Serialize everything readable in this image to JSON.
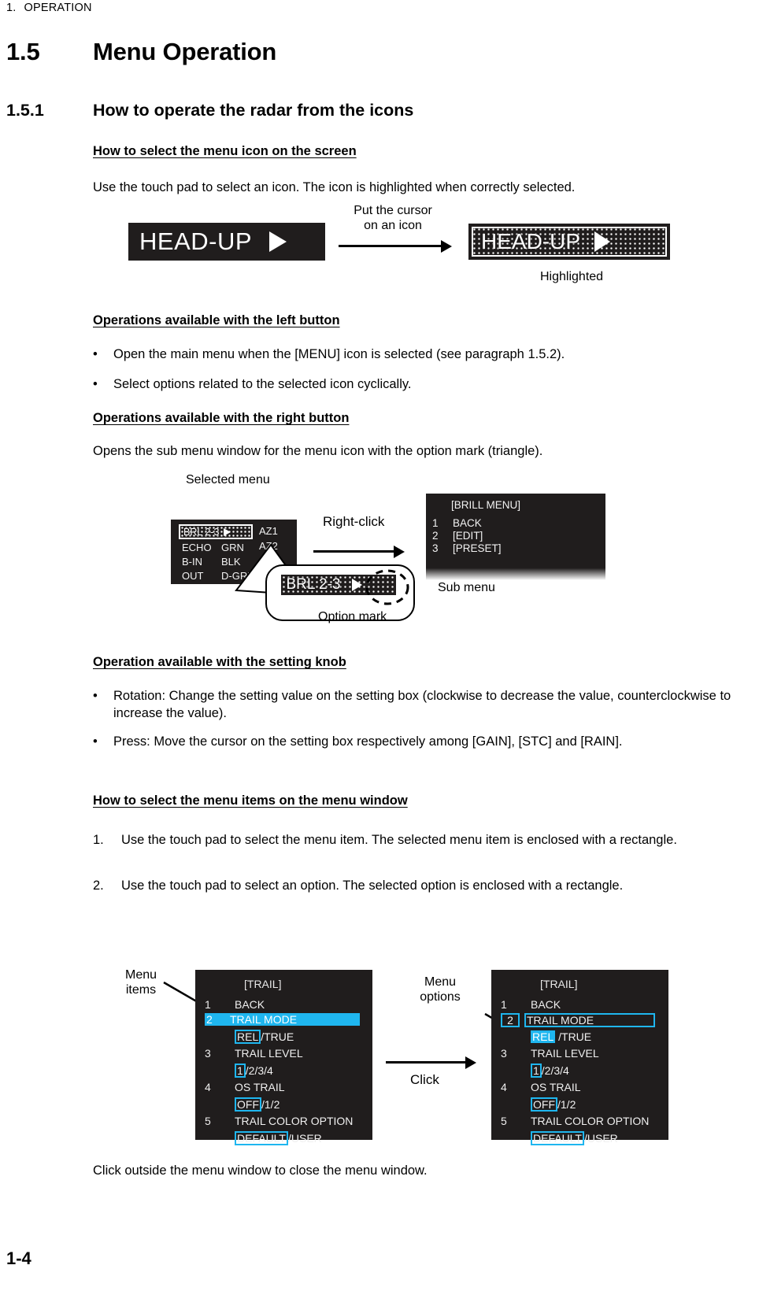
{
  "running_header": {
    "number": "1.",
    "title": "OPERATION"
  },
  "section": {
    "number": "1.5",
    "title": "Menu Operation"
  },
  "subsection": {
    "number": "1.5.1",
    "title": "How to operate the radar from the icons"
  },
  "headings": {
    "select_icon": "How to select the menu icon on the screen",
    "left_button": "Operations available with the left button",
    "right_button": "Operations available with the right button",
    "setting_knob": "Operation available with the setting knob",
    "menu_items": "How to select the menu items on the menu window"
  },
  "paragraphs": {
    "touch_pad": "Use the touch pad to select an icon. The icon is highlighted when correctly selected.",
    "opens_sub_menu": "Opens the sub menu window for the menu icon with the option mark (triangle).",
    "click_outside": "Click outside the menu window to close the menu window."
  },
  "bullets": {
    "left_button": [
      "Open the main menu when the [MENU] icon is selected (see paragraph 1.5.2).",
      "Select options related to the selected icon cyclically."
    ],
    "setting_knob": [
      "Rotation: Change the setting value on the setting box (clockwise to decrease the value, counterclockwise to increase the value).",
      "Press: Move the cursor on the setting box respectively among [GAIN], [STC] and [RAIN]."
    ]
  },
  "numbered_steps": [
    {
      "number": "1.",
      "text": "Use the touch pad to select the menu item. The selected menu item is enclosed with a rectangle."
    },
    {
      "number": "2.",
      "text": "Use the touch pad to select an option. The selected option is enclosed with a rectangle."
    }
  ],
  "figure_headup": {
    "icon_label": "HEAD-UP",
    "option_mark": "triangle-right",
    "annotation_cursor": "Put the cursor\non an icon",
    "annotation_cursor_line1": "Put the cursor",
    "annotation_cursor_line2": "on an icon",
    "annotation_highlighted": "Highlighted"
  },
  "figure_brill": {
    "selected_menu_label": "Selected menu",
    "right_click_label": "Right-click",
    "option_mark_label": "Option mark",
    "sub_menu_label": "Sub menu",
    "radar_panel": {
      "selected_item": "BRL 2-3",
      "right_column": [
        "AZ1",
        "AZ2"
      ],
      "rows": [
        {
          "left": "ECHO",
          "right": "GRN"
        },
        {
          "left": "B-IN",
          "right": "BLK"
        },
        {
          "left": "OUT",
          "right": "D-GRN"
        }
      ]
    },
    "magnified_item": "BRL 2-3",
    "sub_menu": {
      "title": "[BRILL MENU]",
      "items": [
        {
          "index": "1",
          "label": "BACK"
        },
        {
          "index": "2",
          "label": "[EDIT]"
        },
        {
          "index": "3",
          "label": "[PRESET]"
        }
      ]
    }
  },
  "figure_trail": {
    "menu_items_label_line1": "Menu",
    "menu_items_label_line2": "items",
    "menu_options_label_line1": "Menu",
    "menu_options_label_line2": "options",
    "click_label": "Click",
    "left_panel": {
      "title": "[TRAIL]",
      "rows": [
        {
          "index": "1",
          "name": "BACK",
          "options": null,
          "name_style": "plain"
        },
        {
          "index": "2",
          "name": "TRAIL MODE",
          "options": [
            "REL",
            "TRUE"
          ],
          "name_style": "fill",
          "selected_option": "REL",
          "option_style": "box"
        },
        {
          "index": "3",
          "name": "TRAIL LEVEL",
          "options": [
            "1",
            "2",
            "3",
            "4"
          ],
          "name_style": "plain",
          "selected_option": "1",
          "option_style": "box"
        },
        {
          "index": "4",
          "name": "OS TRAIL",
          "options": [
            "OFF",
            "1",
            "2"
          ],
          "name_style": "plain",
          "selected_option": "OFF",
          "option_style": "box"
        },
        {
          "index": "5",
          "name": "TRAIL COLOR OPTION",
          "options": [
            "DEFAULT",
            "USER"
          ],
          "name_style": "plain",
          "selected_option": "DEFAULT",
          "option_style": "box"
        }
      ]
    },
    "right_panel": {
      "title": "[TRAIL]",
      "rows": [
        {
          "index": "1",
          "name": "BACK",
          "options": null,
          "name_style": "plain"
        },
        {
          "index": "2",
          "name": "TRAIL MODE",
          "options": [
            "REL",
            "TRUE"
          ],
          "name_style": "box",
          "selected_option": "REL",
          "option_style": "fill"
        },
        {
          "index": "3",
          "name": "TRAIL LEVEL",
          "options": [
            "1",
            "2",
            "3",
            "4"
          ],
          "name_style": "plain",
          "selected_option": "1",
          "option_style": "box"
        },
        {
          "index": "4",
          "name": "OS TRAIL",
          "options": [
            "OFF",
            "1",
            "2"
          ],
          "name_style": "plain",
          "selected_option": "OFF",
          "option_style": "box"
        },
        {
          "index": "5",
          "name": "TRAIL COLOR OPTION",
          "options": [
            "DEFAULT",
            "USER"
          ],
          "name_style": "plain",
          "selected_option": "DEFAULT",
          "option_style": "box"
        }
      ]
    }
  },
  "colors": {
    "highlight_cyan": "#1fb6ef",
    "screen_background": "#201d1d",
    "screen_text": "#f0f0f0"
  },
  "footer": {
    "page_number": "1-4"
  }
}
